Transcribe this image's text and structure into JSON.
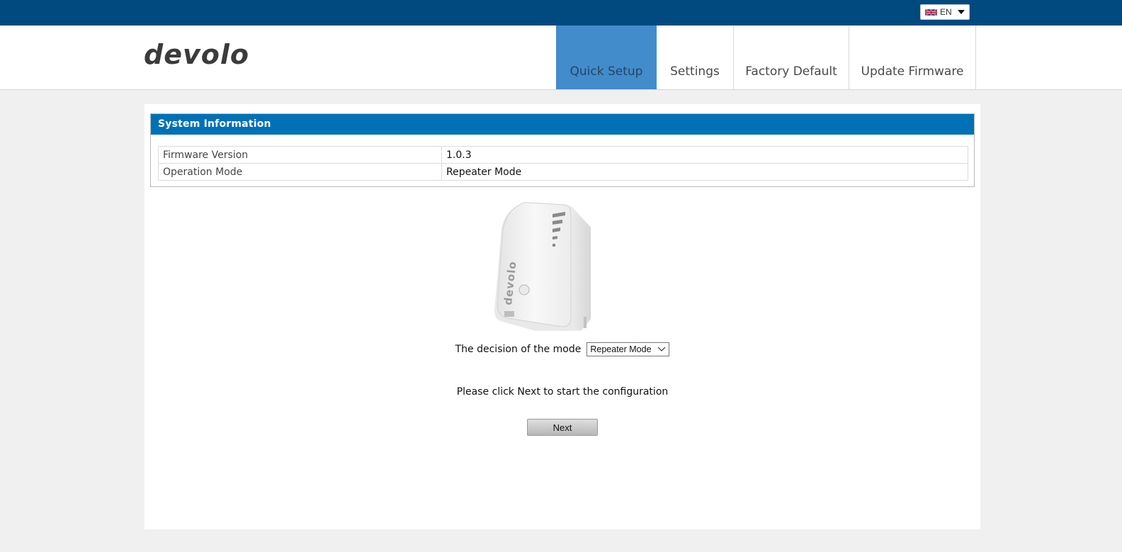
{
  "colors": {
    "topbar": "#004a80",
    "nav_active": "#428ccc",
    "panel_header": "#0071b7",
    "page_bg": "#f0f0f1"
  },
  "topbar": {
    "language": {
      "flag_icon": "uk-flag-icon",
      "label": "EN",
      "dropdown_icon": "caret-down-icon"
    }
  },
  "header": {
    "logo_text": "devolo",
    "nav": [
      {
        "label": "Quick Setup",
        "active": true
      },
      {
        "label": "Settings",
        "active": false
      },
      {
        "label": "Factory Default",
        "active": false
      },
      {
        "label": "Update Firmware",
        "active": false
      }
    ]
  },
  "system_info": {
    "title": "System Information",
    "rows": [
      {
        "key": "Firmware Version",
        "value": "1.0.3"
      },
      {
        "key": "Operation Mode",
        "value": "Repeater Mode"
      }
    ]
  },
  "mode": {
    "label": "The decision of the mode",
    "selected": "Repeater Mode"
  },
  "hint": "Please click Next to start the configuration",
  "next_label": "Next"
}
